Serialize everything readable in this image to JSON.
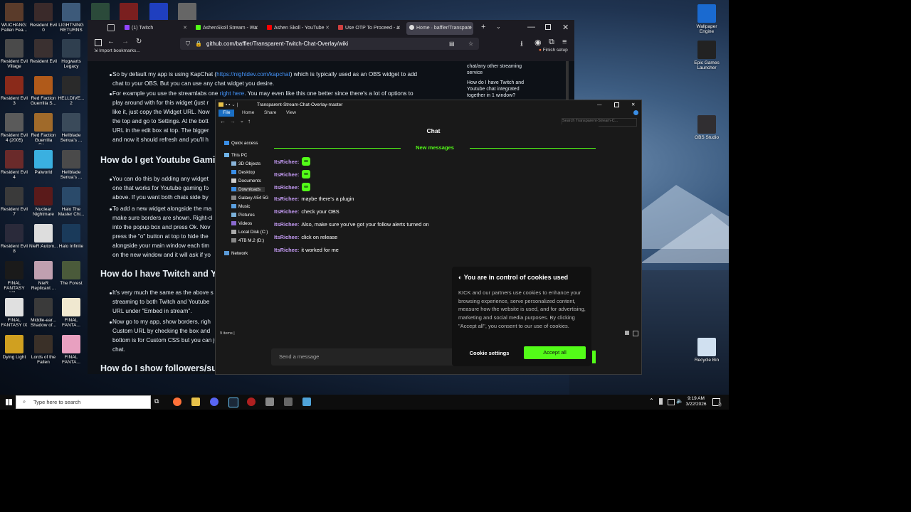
{
  "desktop_icons": [
    {
      "label": "WUCHANG: Fallen Fea...",
      "color": "#5a3b2a"
    },
    {
      "label": "Resident Evil 0",
      "color": "#3a2a2a"
    },
    {
      "label": "LIGHTNING RETURNS F...",
      "color": "#3d5a7a"
    },
    {
      "label": "",
      "color": "#2b4a3a"
    },
    {
      "label": "",
      "color": "#7a1f1f"
    },
    {
      "label": "",
      "color": "#1f3fbf"
    },
    {
      "label": "",
      "color": "#666666"
    },
    {
      "label": "Resident Evil Village",
      "color": "#4a4a4a"
    },
    {
      "label": "Resident Evil",
      "color": "#3a3030"
    },
    {
      "label": "Hogwarts Legacy",
      "color": "#2f3f4f"
    },
    {
      "label": "Resident Evil 3",
      "color": "#8a2a1a"
    },
    {
      "label": "Red Faction Guerrilla S...",
      "color": "#b05a1a"
    },
    {
      "label": "HELLDIVE... 2",
      "color": "#2a2a2a"
    },
    {
      "label": "Resident Evil 4 (2005)",
      "color": "#5a5a5a"
    },
    {
      "label": "Red Faction Guerrilla Re...",
      "color": "#a06a2a"
    },
    {
      "label": "Hellblade Senua's ...",
      "color": "#3a4a5a"
    },
    {
      "label": "Resident Evil 4",
      "color": "#6a2a2a"
    },
    {
      "label": "Palworld",
      "color": "#3ab0e0"
    },
    {
      "label": "Hellblade Senua's ...",
      "color": "#4a4a4a"
    },
    {
      "label": "Resident Evil 7",
      "color": "#3a3a3a"
    },
    {
      "label": "Nuclear Nightmare",
      "color": "#5a1a1a"
    },
    {
      "label": "Halo The Master Chi...",
      "color": "#2a4a6a"
    },
    {
      "label": "Resident Evil 8",
      "color": "#2a2a3a"
    },
    {
      "label": "NieR:Autom...",
      "color": "#dddddd"
    },
    {
      "label": "Halo Infinite",
      "color": "#1a3a5a"
    },
    {
      "label": "FINAL FANTASY VII...",
      "color": "#1a1a1a"
    },
    {
      "label": "NieR Replicant ...",
      "color": "#c0a0b0"
    },
    {
      "label": "The Forest",
      "color": "#4a5a3a"
    },
    {
      "label": "FINAL FANTASY IX",
      "color": "#e0e0e0"
    },
    {
      "label": "Middle-ear... Shadow of...",
      "color": "#3a3a3a"
    },
    {
      "label": "FINAL FANTA...",
      "color": "#f0e8d0"
    },
    {
      "label": "Dying Light",
      "color": "#d0a020"
    },
    {
      "label": "Lords of the Fallen",
      "color": "#3a3028"
    },
    {
      "label": "FINAL FANTA...",
      "color": "#e8a0c0"
    }
  ],
  "right_icons": [
    {
      "label": "Wallpaper Engine",
      "color": "#1a6ad0"
    },
    {
      "label": "Epic Games Launcher",
      "color": "#222222"
    },
    {
      "label": "OBS Studio",
      "color": "#302e31"
    },
    {
      "label": "Recycle Bin",
      "color": "#d0e0f0"
    }
  ],
  "browser": {
    "tabs": [
      "(1) Twitch",
      "AshenSkoll Stream - Wa",
      "Ashen Skoll - YouTube",
      "Use OTP To Proceed - a",
      "Home · baffler/Transpare"
    ],
    "new_tab": "+",
    "url": "github.com/baffler/Transparent-Twitch-Chat-Overlay/wiki",
    "bookmark": "Import bookmarks...",
    "finish_setup": "Finish setup"
  },
  "wiki": {
    "p1a": "So by default my app is using KapChat (",
    "p1_link": "https://nightdev.com/kapchat",
    "p1b": ") which is typically used as an OBS widget to add",
    "p1c": "chat to your OBS. But you can use any chat widget you desire.",
    "p2a": "For example you use the streamlabs one ",
    "p2_link": "right here",
    "p2b": ". You may even like this one better since there's a lot of options to",
    "p2c": "play around with for this widget (just r",
    "p2d": "like it, just copy the Widget URL. Now",
    "p2e": "the top and go to Settings. At the bott",
    "p2f": "URL in the edit box at top. The bigger",
    "p2g": "and now it should refresh and you'll h",
    "h1": "How do I get Youtube Gami",
    "p3a": "You can do this by adding any widget",
    "p3b": "one that works for Youtube gaming fo",
    "p3c": "above. If you want both chats side by",
    "p4a": "To add a new widget alongside the ma",
    "p4b": "make sure borders are shown. Right-cl",
    "p4c": "into the popup box and press Ok. Nov",
    "p4d": "press the \"o\" button at top to hide the",
    "p4e": "alongside your main window each tim",
    "p4f": "on the new window and it will ask if yo",
    "h2": "How do I have Twitch and Y",
    "p5a": "It's very much the same as the above s",
    "p5b": "streaming to both Twitch and Youtube",
    "p5c": "URL under \"Embed in stream\".",
    "p6a": "Now go to my app, show borders, righ",
    "p6b": "Custom URL by checking the box and",
    "p6c": "bottom is for Custom CSS but you can just leave this blank",
    "p6d": "chat.",
    "h3": "How do I show followers/subs/redemptio"
  },
  "wiki_sidebar": {
    "item1a": "chat/any other streaming",
    "item1b": "service",
    "item2a": "How do I have Twitch and",
    "item2b": "Youtube chat integrated",
    "item2c": "together in 1 window?"
  },
  "explorer": {
    "title": "Transparent-Stream-Chat-Overlay-master",
    "ribbon": [
      "File",
      "Home",
      "Share",
      "View"
    ],
    "search": "Search Transparent-Stream-C...",
    "nav": [
      {
        "label": "Quick access",
        "color": "#3a8ee6"
      },
      {
        "label": "This PC",
        "color": "#6fb3e8"
      },
      {
        "label": "3D Objects",
        "color": "#8ab4d8"
      },
      {
        "label": "Desktop",
        "color": "#3a8ee6"
      },
      {
        "label": "Documents",
        "color": "#cfcfcf"
      },
      {
        "label": "Downloads",
        "color": "#3a8ee6"
      },
      {
        "label": "Galaxy A54 5G",
        "color": "#888888"
      },
      {
        "label": "Music",
        "color": "#5aa0e0"
      },
      {
        "label": "Pictures",
        "color": "#7ab0d8"
      },
      {
        "label": "Videos",
        "color": "#8a6ad0"
      },
      {
        "label": "Local Disk (C:)",
        "color": "#aaaaaa"
      },
      {
        "label": "4TB M.2 (D:)",
        "color": "#888888"
      },
      {
        "label": "Network",
        "color": "#5a9ad8"
      }
    ],
    "status": "9 items"
  },
  "chat": {
    "title": "Chat",
    "new_messages": "New messages",
    "messages": [
      {
        "user": "ItsRichee:",
        "text": ""
      },
      {
        "user": "ItsRichee:",
        "text": ""
      },
      {
        "user": "ItsRichee:",
        "text": ""
      },
      {
        "user": "ItsRichee:",
        "text": "maybe there's a plugin"
      },
      {
        "user": "ItsRichee:",
        "text": "check your OBS"
      },
      {
        "user": "ItsRichee:",
        "text": "Also, make sure you've got your follow alerts turned on"
      },
      {
        "user": "ItsRichee:",
        "text": "click on release"
      },
      {
        "user": "ItsRichee:",
        "text": "it worked for me"
      }
    ],
    "input_placeholder": "Send a message"
  },
  "cookie": {
    "title": "You are in control of cookies used",
    "body": "KICK and our partners use cookies to enhance your browsing experience, serve personalized content, measure how the website is used, and for advertising, marketing and social media purposes. By clicking \"Accept all\", you consent to our use of cookies.",
    "settings": "Cookie settings",
    "accept": "Accept all"
  },
  "taskbar": {
    "search_placeholder": "Type here to search",
    "time": "9:19 AM",
    "date": "3/22/2026",
    "notification_count": "2"
  }
}
